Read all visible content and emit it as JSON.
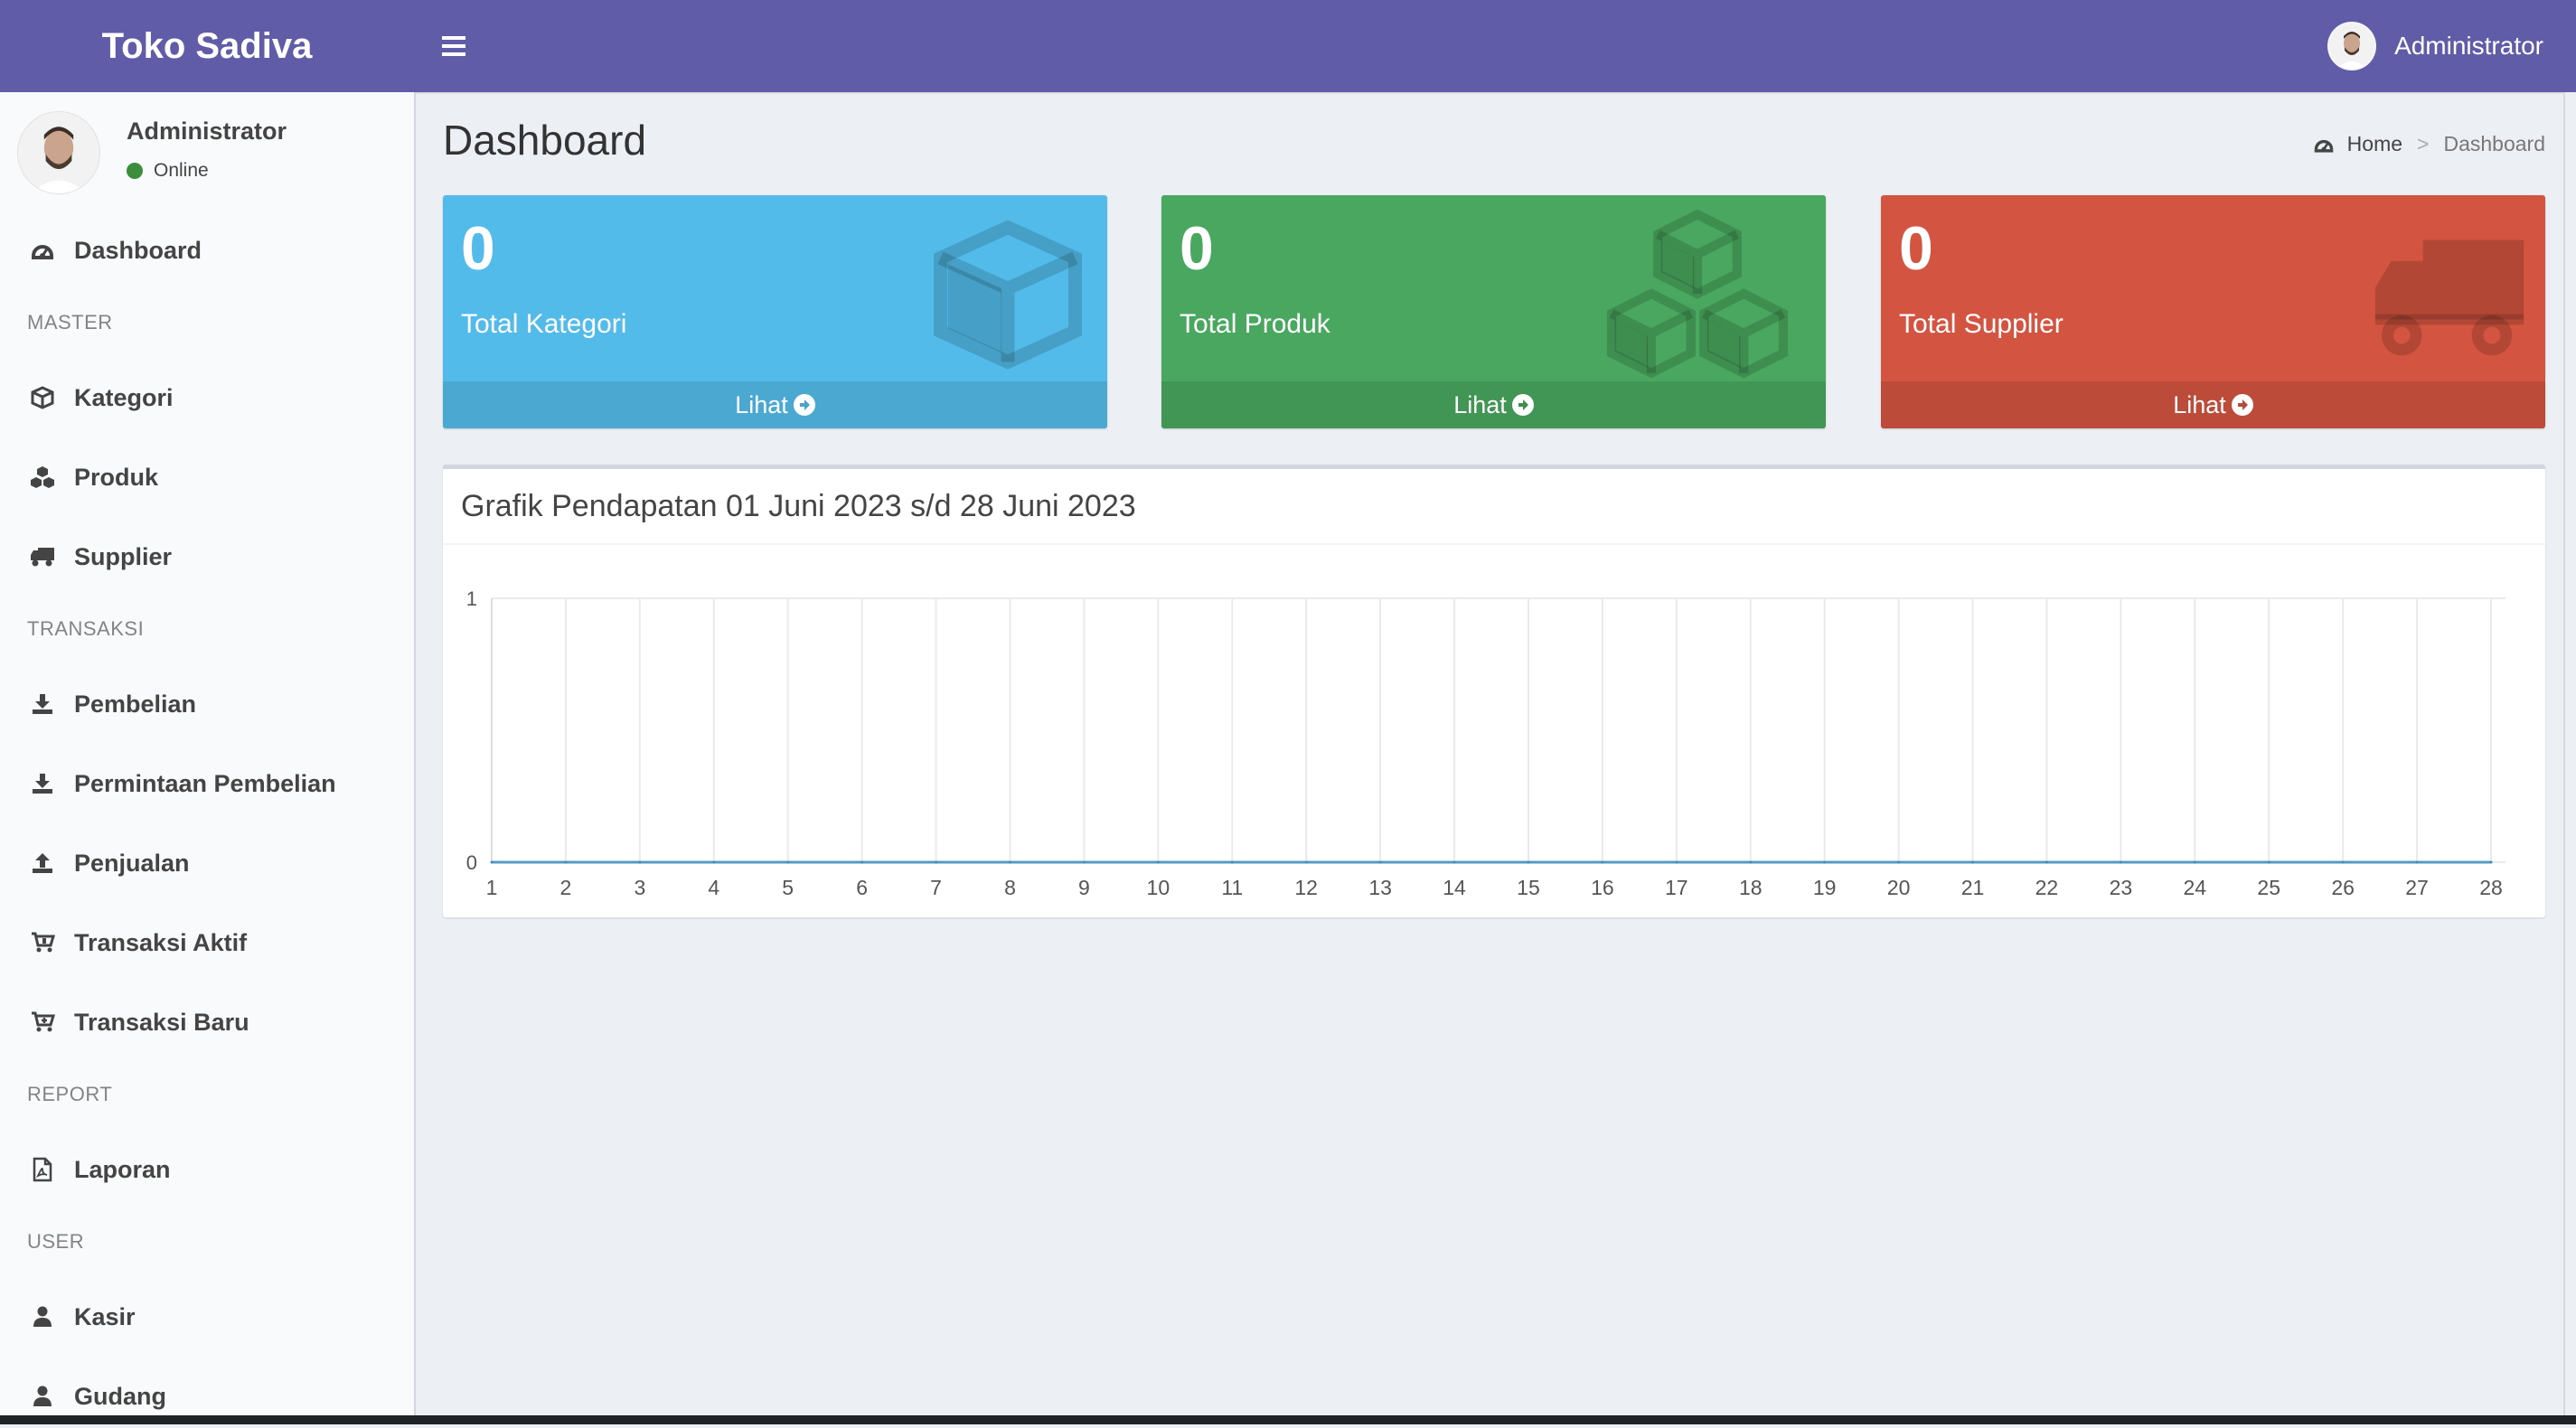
{
  "header": {
    "brand": "Toko Sadiva",
    "user": "Administrator"
  },
  "user_panel": {
    "name": "Administrator",
    "status": "Online"
  },
  "sidebar": {
    "dashboard": "Dashboard",
    "master_header": "MASTER",
    "kategori": "Kategori",
    "produk": "Produk",
    "supplier": "Supplier",
    "transaksi_header": "TRANSAKSI",
    "pembelian": "Pembelian",
    "permintaan_pembelian": "Permintaan Pembelian",
    "penjualan": "Penjualan",
    "transaksi_aktif": "Transaksi Aktif",
    "transaksi_baru": "Transaksi Baru",
    "report_header": "REPORT",
    "laporan": "Laporan",
    "user_header": "USER",
    "kasir": "Kasir",
    "gudang": "Gudang"
  },
  "page": {
    "title": "Dashboard"
  },
  "breadcrumb": {
    "home": "Home",
    "sep": ">",
    "current": "Dashboard"
  },
  "boxes": {
    "kategori": {
      "value": "0",
      "label": "Total Kategori",
      "link": "Lihat"
    },
    "produk": {
      "value": "0",
      "label": "Total Produk",
      "link": "Lihat"
    },
    "supplier": {
      "value": "0",
      "label": "Total Supplier",
      "link": "Lihat"
    }
  },
  "colors": {
    "header": "#605ca8",
    "aqua": "#53bbe9",
    "green": "#49a75f",
    "red": "#d35440",
    "line": "#3c8dbc"
  },
  "chart_panel": {
    "title": "Grafik Pendapatan 01 Juni 2023 s/d 28 Juni 2023"
  },
  "chart_data": {
    "type": "line",
    "title": "Grafik Pendapatan 01 Juni 2023 s/d 28 Juni 2023",
    "xlabel": "",
    "ylabel": "",
    "x": [
      1,
      2,
      3,
      4,
      5,
      6,
      7,
      8,
      9,
      10,
      11,
      12,
      13,
      14,
      15,
      16,
      17,
      18,
      19,
      20,
      21,
      22,
      23,
      24,
      25,
      26,
      27,
      28
    ],
    "series": [
      {
        "values": [
          0,
          0,
          0,
          0,
          0,
          0,
          0,
          0,
          0,
          0,
          0,
          0,
          0,
          0,
          0,
          0,
          0,
          0,
          0,
          0,
          0,
          0,
          0,
          0,
          0,
          0,
          0,
          0
        ]
      }
    ],
    "ylim": [
      0,
      1
    ],
    "yticks": [
      0,
      1
    ],
    "grid": true
  }
}
